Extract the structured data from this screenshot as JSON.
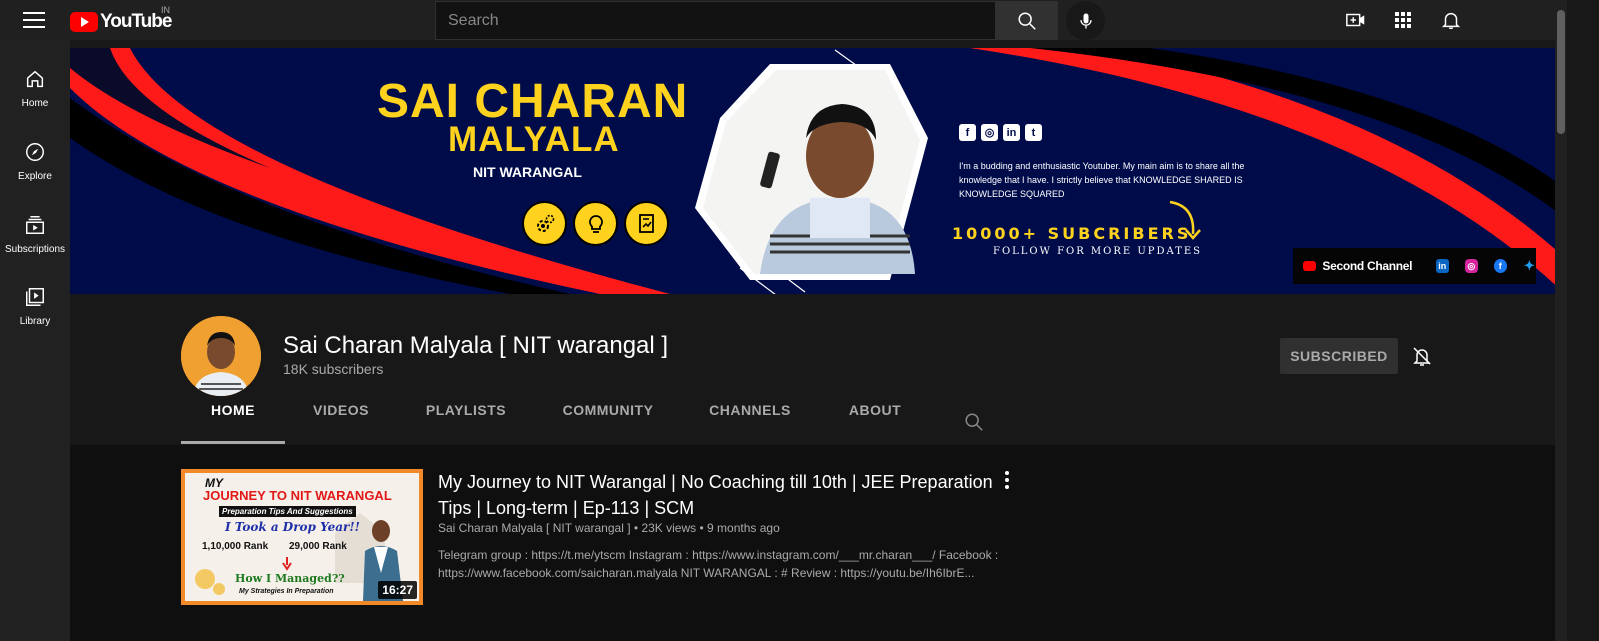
{
  "header": {
    "logo_text": "YouTube",
    "country_code": "IN",
    "search_placeholder": "Search",
    "icons": [
      "menu-icon",
      "search-icon",
      "microphone-icon",
      "create-video-icon",
      "apps-grid-icon",
      "notifications-bell-icon"
    ]
  },
  "sidebar": {
    "items": [
      {
        "label": "Home",
        "icon": "home-icon"
      },
      {
        "label": "Explore",
        "icon": "compass-icon"
      },
      {
        "label": "Subscriptions",
        "icon": "subscriptions-icon"
      },
      {
        "label": "Library",
        "icon": "library-icon"
      }
    ]
  },
  "banner": {
    "name_line1": "SAI CHARAN",
    "name_line2": "MALYALA",
    "college": "NIT WARANGAL",
    "description": "I'm a budding and enthusiastic Youtuber. My main aim is to share all the knowledge that I have. I strictly believe that KNOWLEDGE SHARED IS KNOWLEDGE SQUARED",
    "subscribers_goal": "10000+ SUBCRIBERS",
    "follow_text": "FOLLOW FOR MORE UPDATES",
    "second_channel": "Second Channel",
    "colors": {
      "navy": "#000c4a",
      "red": "#ff1a1a",
      "yellow": "#ffd21e"
    }
  },
  "channel": {
    "name": "Sai Charan Malyala [ NIT warangal ]",
    "subscribers": "18K subscribers",
    "subscribe_label": "SUBSCRIBED",
    "tabs": [
      "HOME",
      "VIDEOS",
      "PLAYLISTS",
      "COMMUNITY",
      "CHANNELS",
      "ABOUT"
    ],
    "active_tab": "HOME"
  },
  "video": {
    "title": "My Journey to NIT Warangal | No Coaching till 10th | JEE Preparation Tips | Long-term | Ep-113 | SCM",
    "channel": "Sai Charan Malyala [ NIT warangal ]",
    "views": "23K views",
    "age": "9 months ago",
    "description": "Telegram group : https://t.me/ytscm Instagram : https://www.instagram.com/___mr.charan___/ Facebook : https://www.facebook.com/saicharan.malyala NIT WARANGAL : # Review : https://youtu.be/Ih6IbrE...",
    "duration": "16:27",
    "thumbnail": {
      "line1": "MY",
      "line2": "JOURNEY TO NIT WARANGAL",
      "line3": "Preparation Tips And Suggestions",
      "line4": "I Took a Drop Year!!",
      "rank_from": "1,10,000 Rank",
      "rank_to": "29,000 Rank",
      "line6": "How I Managed??",
      "line7": "My Strategies In Preparation"
    }
  }
}
